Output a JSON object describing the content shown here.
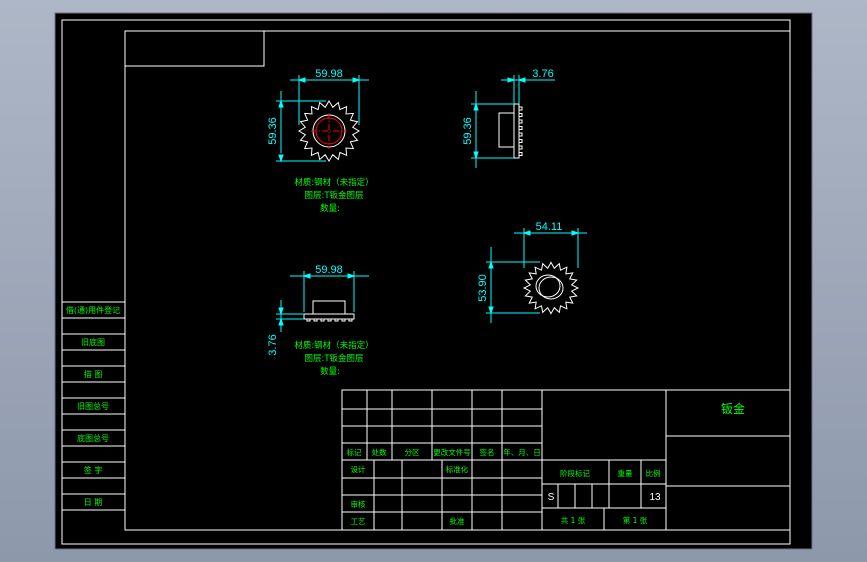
{
  "colors": {
    "background": "#000000",
    "frame": "#ffffff",
    "dimension": "#00ffff",
    "note": "#00ff00",
    "part": "#ffffff",
    "center": "#ff0000",
    "table_text": "#00ff00"
  },
  "views": {
    "front": {
      "width": "59.98",
      "height": "59.36"
    },
    "side": {
      "thickness": "3.76",
      "height": "59.36"
    },
    "top": {
      "width": "59.98",
      "thickness": "3.76"
    },
    "iso": {
      "width": "54.11",
      "height": "53.90"
    }
  },
  "notes": {
    "line1": "材质:钢材（未指定）",
    "line2": "图层:T钣金图层",
    "line3": "数量:"
  },
  "side_table": [
    "借(通)用件登记",
    "旧底图",
    "描 图",
    "旧图总号",
    "底图总号",
    "签 字",
    "日 期"
  ],
  "title_block": {
    "part_name": "钣金",
    "header_cells": [
      "标记",
      "处数",
      "分区",
      "更改文件号",
      "签名",
      "年、月、日"
    ],
    "role_design": "设计",
    "role_standard": "标准化",
    "role_review": "审核",
    "role_process": "工艺",
    "role_approve": "批准",
    "stage_header": "阶段标记",
    "weight_header": "重量",
    "scale_header": "比例",
    "stage_value": "S",
    "scale_value": "13",
    "sheets_total": "共 1 张",
    "sheet_no": "第 1 张"
  }
}
